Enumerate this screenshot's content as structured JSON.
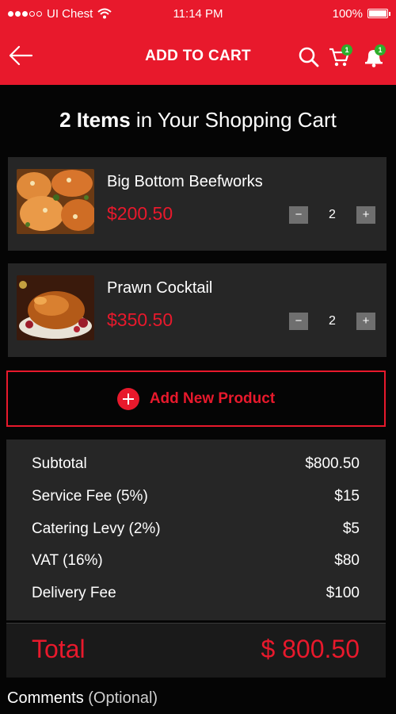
{
  "status_bar": {
    "carrier": "UI Chest",
    "time": "11:14 PM",
    "battery": "100%",
    "battery_level": 1.0
  },
  "header": {
    "title": "ADD TO CART",
    "cart_badge": "1",
    "notification_badge": "1"
  },
  "cart_heading": {
    "count": "2 Items",
    "rest": " in Your Shopping Cart"
  },
  "items": [
    {
      "name": "Big Bottom Beefworks",
      "price": "$200.50",
      "quantity": "2",
      "minus": "−",
      "plus": "+"
    },
    {
      "name": "Prawn Cocktail",
      "price": "$350.50",
      "quantity": "2",
      "minus": "−",
      "plus": "+"
    }
  ],
  "add_product": {
    "label": "Add New Product"
  },
  "summary": {
    "rows": [
      {
        "label": "Subtotal",
        "value": "$800.50"
      },
      {
        "label": "Service Fee (5%)",
        "value": "$15"
      },
      {
        "label": "Catering Levy (2%)",
        "value": "$5"
      },
      {
        "label": "VAT (16%)",
        "value": "$80"
      },
      {
        "label": "Delivery Fee",
        "value": "$100"
      }
    ],
    "total_label": "Total",
    "total_value": "$ 800.50"
  },
  "comments": {
    "label": "Comments",
    "optional": "(Optional)"
  },
  "colors": {
    "accent": "#e8192c",
    "badge": "#2fae2c",
    "panel": "#262626",
    "background": "#050505"
  }
}
